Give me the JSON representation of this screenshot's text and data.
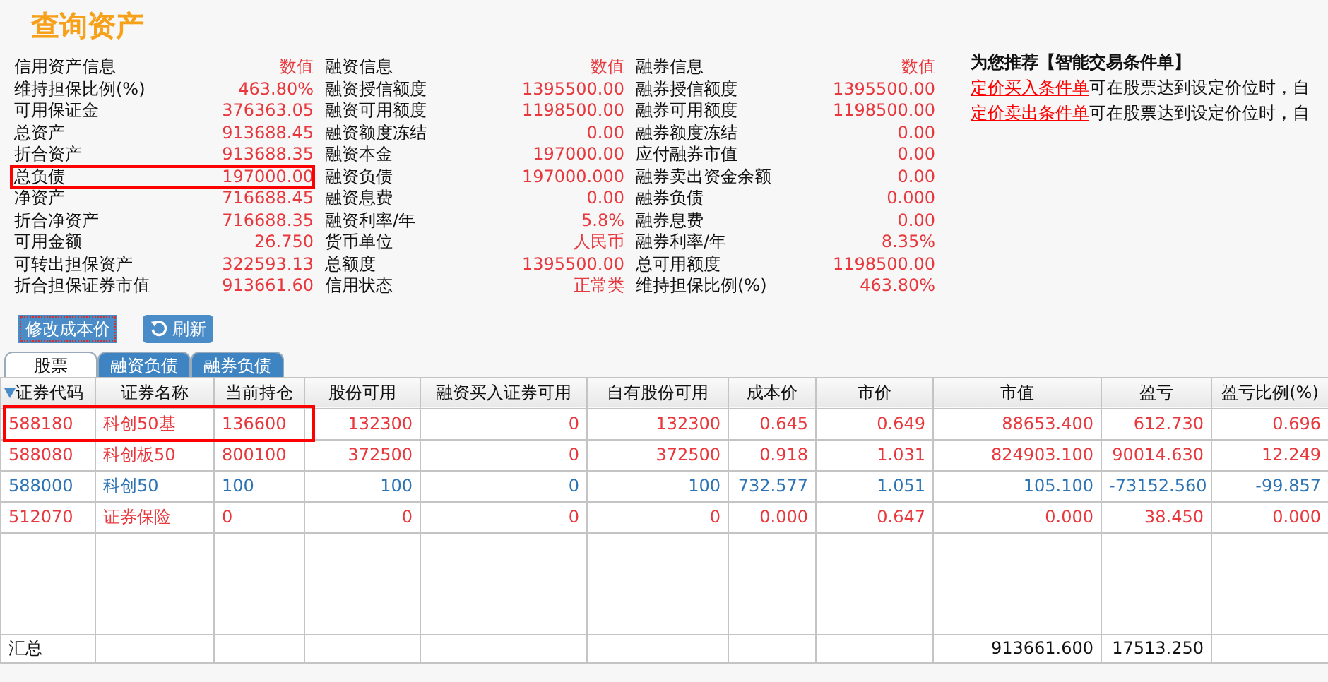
{
  "title": "查询资产",
  "info": [
    {
      "header": "信用资产信息",
      "value_header": "数值",
      "rows": [
        {
          "label": "维持担保比例(%)",
          "value": "463.80%",
          "highlighted": false
        },
        {
          "label": "可用保证金",
          "value": "376363.05",
          "highlighted": false
        },
        {
          "label": "总资产",
          "value": "913688.45",
          "highlighted": false
        },
        {
          "label": "折合资产",
          "value": "913688.35",
          "highlighted": false
        },
        {
          "label": "总负债",
          "value": "197000.00",
          "highlighted": true
        },
        {
          "label": "净资产",
          "value": "716688.45",
          "highlighted": false
        },
        {
          "label": "折合净资产",
          "value": "716688.35",
          "highlighted": false
        },
        {
          "label": "可用金额",
          "value": "26.750",
          "highlighted": false
        },
        {
          "label": "可转出担保资产",
          "value": "322593.13",
          "highlighted": false
        },
        {
          "label": "折合担保证券市值",
          "value": "913661.60",
          "highlighted": false
        }
      ]
    },
    {
      "header": "融资信息",
      "value_header": "数值",
      "rows": [
        {
          "label": "融资授信额度",
          "value": "1395500.00",
          "highlighted": false
        },
        {
          "label": "融资可用额度",
          "value": "1198500.00",
          "highlighted": false
        },
        {
          "label": "融资额度冻结",
          "value": "0.00",
          "highlighted": false
        },
        {
          "label": "融资本金",
          "value": "197000.00",
          "highlighted": false
        },
        {
          "label": "融资负债",
          "value": "197000.000",
          "highlighted": false
        },
        {
          "label": "融资息费",
          "value": "0.00",
          "highlighted": false
        },
        {
          "label": "融资利率/年",
          "value": "5.8%",
          "highlighted": false
        },
        {
          "label": "货币单位",
          "value": "人民币",
          "highlighted": false
        },
        {
          "label": "总额度",
          "value": "1395500.00",
          "highlighted": false
        },
        {
          "label": "信用状态",
          "value": "正常类",
          "highlighted": false
        }
      ]
    },
    {
      "header": "融券信息",
      "value_header": "数值",
      "rows": [
        {
          "label": "融券授信额度",
          "value": "1395500.00",
          "highlighted": false
        },
        {
          "label": "融券可用额度",
          "value": "1198500.00",
          "highlighted": false
        },
        {
          "label": "融券额度冻结",
          "value": "0.00",
          "highlighted": false
        },
        {
          "label": "应付融券市值",
          "value": "0.00",
          "highlighted": false
        },
        {
          "label": "融券卖出资金余额",
          "value": "0.00",
          "highlighted": false
        },
        {
          "label": "融券负债",
          "value": "0.000",
          "highlighted": false
        },
        {
          "label": "融券息费",
          "value": "0.00",
          "highlighted": false
        },
        {
          "label": "融券利率/年",
          "value": "8.35%",
          "highlighted": false
        },
        {
          "label": "总可用额度",
          "value": "1198500.00",
          "highlighted": false
        },
        {
          "label": "维持担保比例(%)",
          "value": "463.80%",
          "highlighted": false
        }
      ]
    }
  ],
  "recommend": {
    "title": "为您推荐【智能交易条件单】",
    "lines": [
      {
        "link": "定价买入条件单",
        "text": "可在股票达到设定价位时，自"
      },
      {
        "link": "定价卖出条件单",
        "text": "可在股票达到设定价位时，自"
      }
    ]
  },
  "buttons": [
    {
      "label": "修改成本价",
      "kind": "plain"
    },
    {
      "label": "刷新",
      "kind": "refresh"
    }
  ],
  "tabs": [
    {
      "label": "股票",
      "selected": true
    },
    {
      "label": "融资负债",
      "selected": false
    },
    {
      "label": "融券负债",
      "selected": false
    }
  ],
  "table": {
    "columns": [
      {
        "label": "证券代码",
        "sorted": true
      },
      {
        "label": "证券名称",
        "sorted": false
      },
      {
        "label": "当前持仓",
        "sorted": false
      },
      {
        "label": "股份可用",
        "sorted": false
      },
      {
        "label": "融资买入证券可用",
        "sorted": false
      },
      {
        "label": "自有股份可用",
        "sorted": false
      },
      {
        "label": "成本价",
        "sorted": false
      },
      {
        "label": "市价",
        "sorted": false
      },
      {
        "label": "市值",
        "sorted": false
      },
      {
        "label": "盈亏",
        "sorted": false
      },
      {
        "label": "盈亏比例(%)",
        "sorted": false
      }
    ],
    "rows": [
      {
        "color": "#e8383d",
        "highlighted": true,
        "cells": [
          "588180",
          "科创50基",
          "136600",
          "132300",
          "0",
          "132300",
          "0.645",
          "0.649",
          "88653.400",
          "612.730",
          "0.696"
        ]
      },
      {
        "color": "#e8383d",
        "highlighted": false,
        "cells": [
          "588080",
          "科创板50",
          "800100",
          "372500",
          "0",
          "372500",
          "0.918",
          "1.031",
          "824903.100",
          "90014.630",
          "12.249"
        ]
      },
      {
        "color": "#2d74b5",
        "highlighted": false,
        "cells": [
          "588000",
          "科创50",
          "100",
          "100",
          "0",
          "100",
          "732.577",
          "1.051",
          "105.100",
          "-73152.560",
          "-99.857"
        ]
      },
      {
        "color": "#e8383d",
        "highlighted": false,
        "cells": [
          "512070",
          "证券保险",
          "0",
          "0",
          "0",
          "0",
          "0.000",
          "0.647",
          "0.000",
          "38.450",
          "0.000"
        ]
      }
    ],
    "summary": {
      "label": "汇总",
      "market_value": "913661.600",
      "profit": "17513.250"
    }
  }
}
